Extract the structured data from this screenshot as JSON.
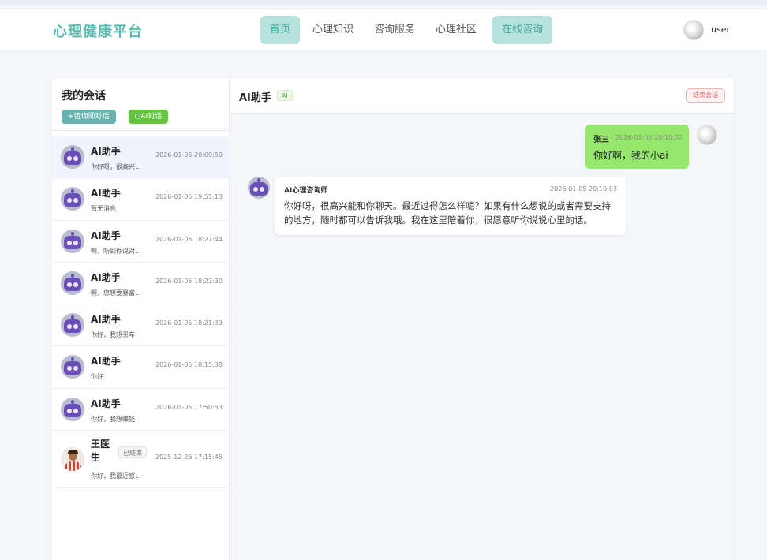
{
  "brand": {
    "logo": "心理健康平台",
    "accent": "#5cbbae"
  },
  "nav": {
    "items": [
      {
        "label": "首页",
        "active": true
      },
      {
        "label": "心理知识"
      },
      {
        "label": "咨询服务"
      },
      {
        "label": "心理社区"
      },
      {
        "label": "在线咨询",
        "highlight": true
      }
    ]
  },
  "user": {
    "name": "user"
  },
  "sidebar": {
    "title": "我的会话",
    "btn_counselor": "+咨询师对话",
    "btn_ai": "○AI对话",
    "conversations": [
      {
        "name": "AI助手",
        "preview": "你好呀，很高兴...",
        "time": "2026-01-05 20:09:50",
        "avatar": "robot-icon",
        "active": true
      },
      {
        "name": "AI助手",
        "preview": "暂无消息",
        "time": "2026-01-05 19:55:13",
        "avatar": "robot-icon"
      },
      {
        "name": "AI助手",
        "preview": "啊，听到你说对...",
        "time": "2026-01-05 18:27:44",
        "avatar": "robot-icon"
      },
      {
        "name": "AI助手",
        "preview": "啊，您想要暴富...",
        "time": "2026-01-05 18:23:30",
        "avatar": "robot-icon"
      },
      {
        "name": "AI助手",
        "preview": "你好，我想买车",
        "time": "2026-01-05 18:21:33",
        "avatar": "robot-icon"
      },
      {
        "name": "AI助手",
        "preview": "你好",
        "time": "2026-01-05 18:15:38",
        "avatar": "robot-icon"
      },
      {
        "name": "AI助手",
        "preview": "你好，我想赚钱",
        "time": "2026-01-05 17:50:53",
        "avatar": "robot-icon"
      },
      {
        "name": "王医生",
        "preview": "你好，我最近感...",
        "time": "2025-12-26 17:15:45",
        "avatar": "doctor-avatar",
        "badge": "已结束"
      }
    ]
  },
  "chat": {
    "title": "AI助手",
    "tag": "AI",
    "end_button": "结束会话",
    "messages": [
      {
        "role": "user",
        "sender": "张三",
        "time": "2026-01-05 20:10:02",
        "text": "你好啊，我的小ai"
      },
      {
        "role": "ai",
        "sender": "AI心理咨询师",
        "time": "2026-01-05 20:10:03",
        "text": "你好呀，很高兴能和你聊天。最近过得怎么样呢？如果有什么想说的或者需要支持的地方，随时都可以告诉我哦。我在这里陪着你，很愿意听你说说心里的话。"
      }
    ]
  }
}
